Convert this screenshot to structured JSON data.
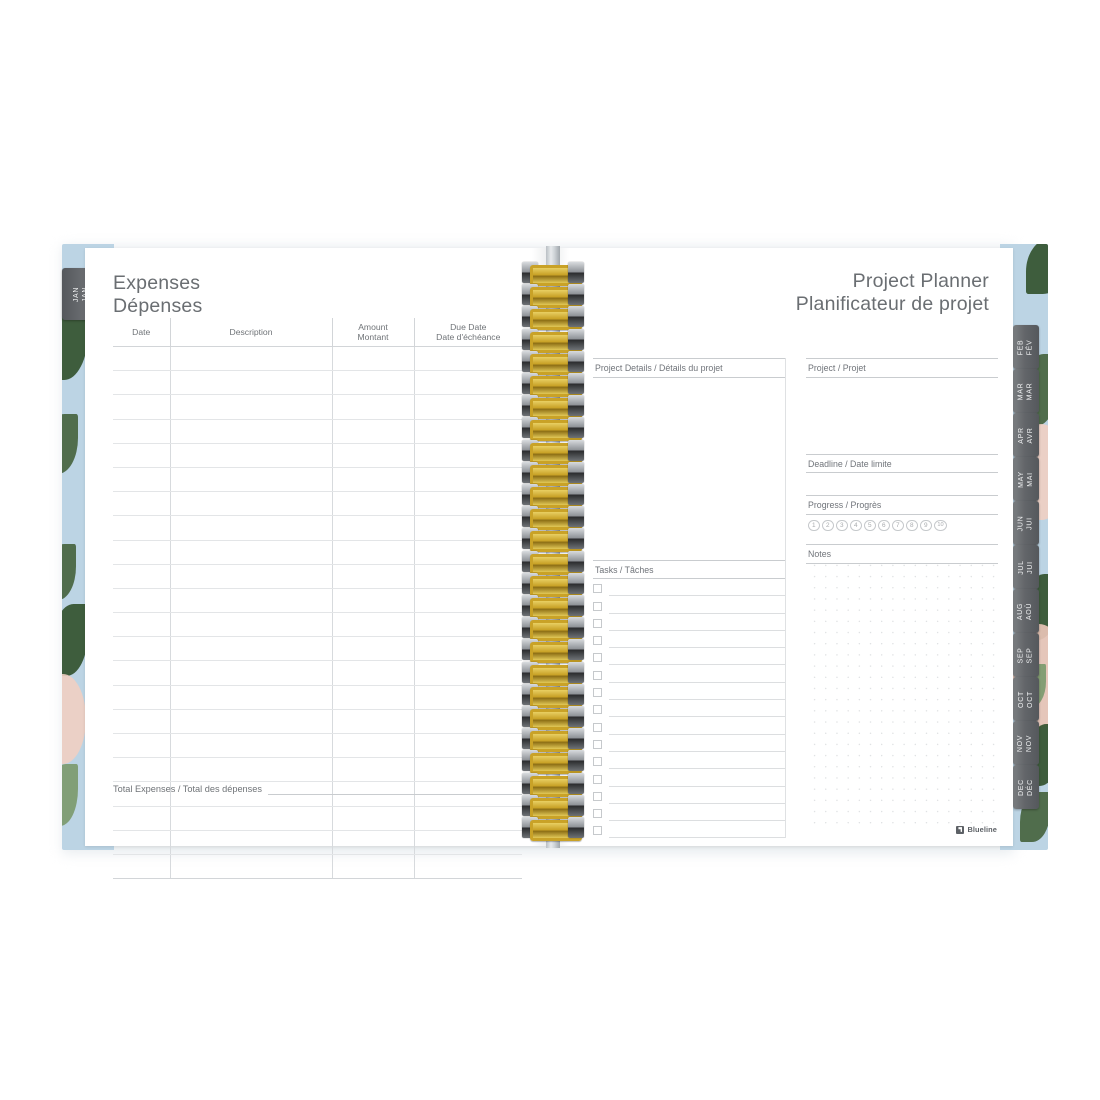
{
  "left_page": {
    "title_en": "Expenses",
    "title_fr": "Dépenses",
    "table": {
      "headers": [
        {
          "en": "Date",
          "fr": ""
        },
        {
          "en": "Description",
          "fr": ""
        },
        {
          "en": "Amount",
          "fr": "Montant"
        },
        {
          "en": "Due Date",
          "fr": "Date d'échéance"
        }
      ],
      "row_count": 22
    },
    "total_label": "Total Expenses / Total des dépenses"
  },
  "right_page": {
    "title_en": "Project Planner",
    "title_fr": "Planificateur de projet",
    "project_details_label": "Project Details / Détails du projet",
    "tasks_label": "Tasks / Tâches",
    "tasks_count": 15,
    "project_label": "Project / Projet",
    "deadline_label": "Deadline / Date limite",
    "progress_label": "Progress / Progrès",
    "progress_numbers": [
      "1",
      "2",
      "3",
      "4",
      "5",
      "6",
      "7",
      "8",
      "9",
      "10"
    ],
    "notes_label": "Notes",
    "brand": "Blueline"
  },
  "tabs": {
    "left": [
      {
        "en": "JAN",
        "fr": "JAN"
      }
    ],
    "right": [
      {
        "en": "FEB",
        "fr": "FÉV"
      },
      {
        "en": "MAR",
        "fr": "MAR"
      },
      {
        "en": "APR",
        "fr": "AVR"
      },
      {
        "en": "MAY",
        "fr": "MAI"
      },
      {
        "en": "JUN",
        "fr": "JUI"
      },
      {
        "en": "JUL",
        "fr": "JUI"
      },
      {
        "en": "AUG",
        "fr": "AOÛ"
      },
      {
        "en": "SEP",
        "fr": "SEP"
      },
      {
        "en": "OCT",
        "fr": "OCT"
      },
      {
        "en": "NOV",
        "fr": "NOV"
      },
      {
        "en": "DEC",
        "fr": "DÉC"
      }
    ]
  },
  "colors": {
    "cover": "#bcd4e4",
    "tab": "#63666a",
    "wire": "#c9a227",
    "rule": "#d2d5d8",
    "text": "#6a6e72"
  }
}
